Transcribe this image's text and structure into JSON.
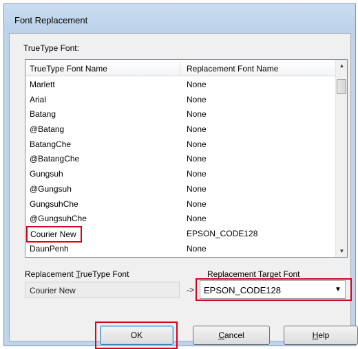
{
  "window": {
    "title": "Font Replacement"
  },
  "group_label": "TrueType Font:",
  "list": {
    "columns": [
      "TrueType Font Name",
      "Replacement Font Name"
    ],
    "rows": [
      {
        "font": "Marlett",
        "replacement": "None"
      },
      {
        "font": "Arial",
        "replacement": "None"
      },
      {
        "font": "Batang",
        "replacement": "None"
      },
      {
        "font": "@Batang",
        "replacement": "None"
      },
      {
        "font": "BatangChe",
        "replacement": "None"
      },
      {
        "font": "@BatangChe",
        "replacement": "None"
      },
      {
        "font": "Gungsuh",
        "replacement": "None"
      },
      {
        "font": "@Gungsuh",
        "replacement": "None"
      },
      {
        "font": "GungsuhChe",
        "replacement": "None"
      },
      {
        "font": "@GungsuhChe",
        "replacement": "None"
      },
      {
        "font": "Courier New",
        "replacement": "EPSON_CODE128"
      },
      {
        "font": "DaunPenh",
        "replacement": "None"
      }
    ]
  },
  "replacement_truetype_font": {
    "label_pre": "Replacement ",
    "label_key": "T",
    "label_post": "rueType Font",
    "value": "Courier New"
  },
  "arrow": "->",
  "replacement_target_font": {
    "label": "Replacement Target Font",
    "selected": "EPSON_CODE128"
  },
  "buttons": {
    "ok": "OK",
    "cancel_key": "C",
    "cancel_rest": "ancel",
    "help_key": "H",
    "help_rest": "elp"
  },
  "colors": {
    "highlight_outline": "#d9001b",
    "window_frame": "#bfd4eb"
  }
}
